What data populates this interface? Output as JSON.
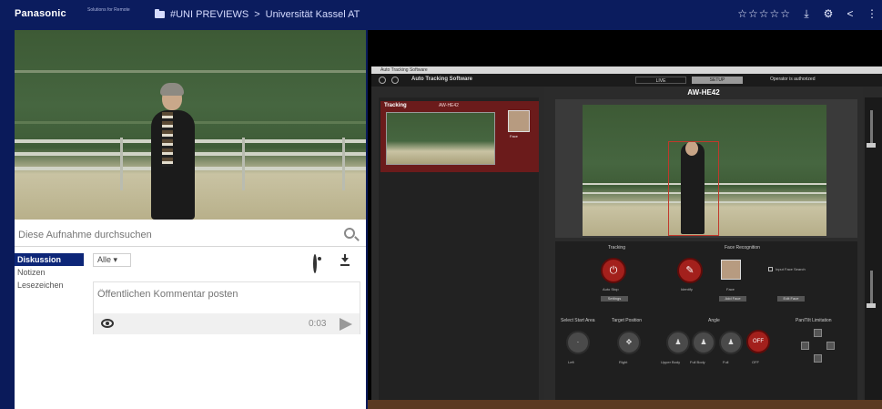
{
  "header": {
    "logo": "Panasonic",
    "logo_sub": "Solutions for Remote",
    "breadcrumb_folder": "#UNI PREVIEWS",
    "breadcrumb_separator": ">",
    "breadcrumb_item": "Universität Kassel AT",
    "stars": "☆☆☆☆☆",
    "icons": [
      "download-icon",
      "gear-icon",
      "share-icon",
      "more-icon"
    ]
  },
  "search": {
    "placeholder": "Diese Aufnahme durchsuchen"
  },
  "tabs": [
    {
      "label": "Diskussion",
      "active": true
    },
    {
      "label": "Notizen",
      "active": false
    },
    {
      "label": "Lesezeichen",
      "active": false
    }
  ],
  "filter": {
    "selected": "Alle",
    "caret": "▾"
  },
  "comment": {
    "placeholder": "Öffentlichen Kommentar posten",
    "timecode": "0:03"
  },
  "software": {
    "window_title": "Auto Tracking Software",
    "app_name": "Auto Tracking Software",
    "toolbar_tabs": [
      "LIVE",
      "SETUP"
    ],
    "status": "Operator is authorized",
    "list_card_title": "Tracking",
    "list_card_model": "AW-HE42",
    "list_face_label": "Face",
    "camera_title": "AW-HE42",
    "sections": {
      "tracking": "Tracking",
      "face_recognition": "Face Recognition",
      "select_start_area": "Select Start Area",
      "target_position": "Target Position",
      "angle": "Angle",
      "pan_tilt": "Pan/Tilt Limitation"
    },
    "labels": {
      "auto_stop": "Auto Stop",
      "identify": "Identify",
      "face_registered": "Face",
      "input_face": "Input Face Search",
      "off": "OFF"
    },
    "mini_buttons": [
      "Settings",
      "Add Face",
      "Edit Face"
    ],
    "angle_labels": [
      "Upper Body",
      "Full Body",
      "Full",
      "OFF"
    ],
    "area_labels": [
      "Left",
      "Right"
    ]
  },
  "colors": {
    "header_bg": "#0b1c5e",
    "tab_active_bg": "#0d2678",
    "tracking_red": "#a3201c"
  }
}
